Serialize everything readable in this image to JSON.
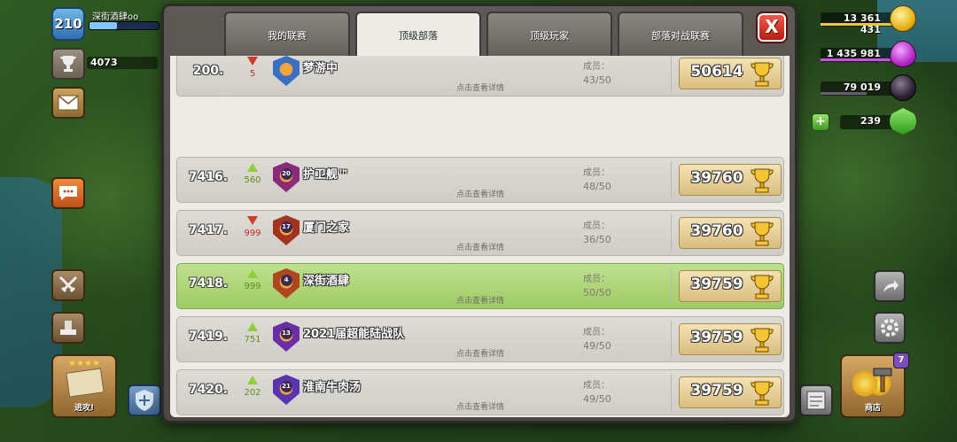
{
  "hud": {
    "level": "210",
    "player_name": "深街酒肆oo",
    "trophies": "4073",
    "attack_label": "进攻!",
    "shop_label": "商店",
    "shop_badge": "7",
    "resources": {
      "gold": "13 361 431",
      "elixir": "1 435 981",
      "dark_elixir": "79 019",
      "gems": "239",
      "gem_plus": "+"
    }
  },
  "modal": {
    "tabs": [
      "我的联赛",
      "顶级部落",
      "顶级玩家",
      "部落对战联赛"
    ],
    "active_tab": 1,
    "close_label": "X",
    "members_label": "成员：",
    "detail_label": "点击查看详情",
    "rows": [
      {
        "rank": "200.",
        "trend": "down",
        "change": "5",
        "badge_level": "",
        "badge_color": "#3a6fc4",
        "name": "梦游中",
        "members": "43/50",
        "score": "50614",
        "mine": false
      },
      {
        "rank": "7416.",
        "trend": "up",
        "change": "560",
        "badge_level": "20",
        "badge_color": "#8a2a7a",
        "name": "护卫舰™",
        "members": "48/50",
        "score": "39760",
        "mine": false
      },
      {
        "rank": "7417.",
        "trend": "down",
        "change": "999",
        "badge_level": "17",
        "badge_color": "#a3321e",
        "name": "厦门之家",
        "members": "36/50",
        "score": "39760",
        "mine": false
      },
      {
        "rank": "7418.",
        "trend": "up",
        "change": "999",
        "badge_level": "4",
        "badge_color": "#b0461f",
        "name": "深街酒肆",
        "members": "50/50",
        "score": "39759",
        "mine": true
      },
      {
        "rank": "7419.",
        "trend": "up",
        "change": "751",
        "badge_level": "13",
        "badge_color": "#6a2fa8",
        "name": "2021届超能陆战队",
        "members": "49/50",
        "score": "39759",
        "mine": false
      },
      {
        "rank": "7420.",
        "trend": "up",
        "change": "202",
        "badge_level": "21",
        "badge_color": "#5a34b0",
        "name": "淮南牛肉汤",
        "members": "49/50",
        "score": "39759",
        "mine": false
      }
    ]
  }
}
